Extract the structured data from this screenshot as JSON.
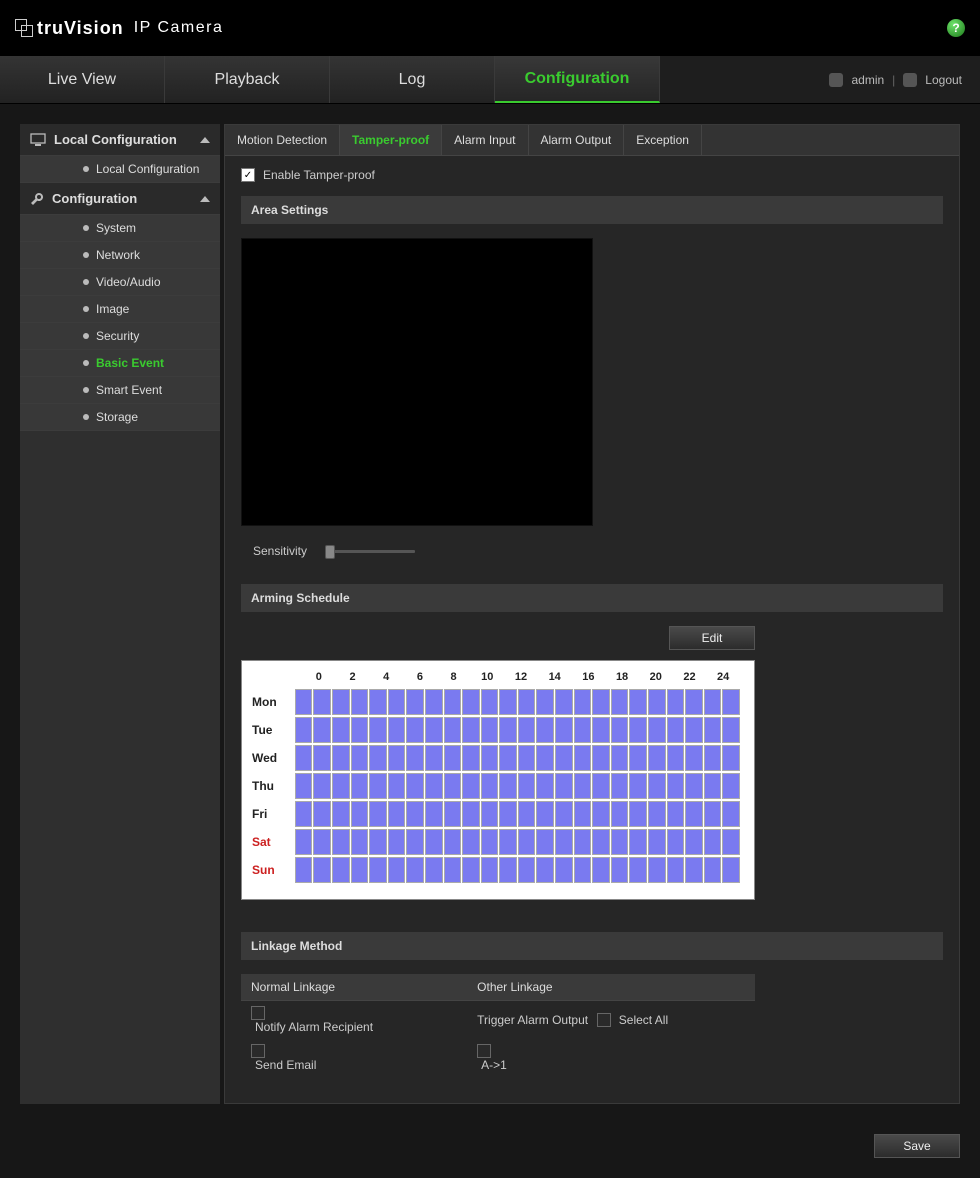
{
  "brand": {
    "main": "truVision",
    "sub": "IP Camera"
  },
  "nav": {
    "tabs": [
      "Live View",
      "Playback",
      "Log",
      "Configuration"
    ],
    "active": "Configuration",
    "user_label": "admin",
    "logout_label": "Logout"
  },
  "sidebar": {
    "sections": [
      {
        "title": "Local Configuration",
        "items": [
          {
            "label": "Local Configuration",
            "active": false
          }
        ]
      },
      {
        "title": "Configuration",
        "items": [
          {
            "label": "System",
            "active": false
          },
          {
            "label": "Network",
            "active": false
          },
          {
            "label": "Video/Audio",
            "active": false
          },
          {
            "label": "Image",
            "active": false
          },
          {
            "label": "Security",
            "active": false
          },
          {
            "label": "Basic Event",
            "active": true
          },
          {
            "label": "Smart Event",
            "active": false
          },
          {
            "label": "Storage",
            "active": false
          }
        ]
      }
    ]
  },
  "sub_tabs": {
    "items": [
      "Motion Detection",
      "Tamper-proof",
      "Alarm Input",
      "Alarm Output",
      "Exception"
    ],
    "active": "Tamper-proof"
  },
  "enable_label": "Enable Tamper-proof",
  "enable_checked": true,
  "area_settings_title": "Area Settings",
  "sensitivity_label": "Sensitivity",
  "sensitivity_value": 0,
  "arming_title": "Arming Schedule",
  "edit_label": "Edit",
  "schedule": {
    "hours": [
      "0",
      "2",
      "4",
      "6",
      "8",
      "10",
      "12",
      "14",
      "16",
      "18",
      "20",
      "22",
      "24"
    ],
    "days": [
      {
        "label": "Mon",
        "weekend": false
      },
      {
        "label": "Tue",
        "weekend": false
      },
      {
        "label": "Wed",
        "weekend": false
      },
      {
        "label": "Thu",
        "weekend": false
      },
      {
        "label": "Fri",
        "weekend": false
      },
      {
        "label": "Sat",
        "weekend": true
      },
      {
        "label": "Sun",
        "weekend": true
      }
    ],
    "cells_per_day": 24,
    "all_filled": true
  },
  "linkage": {
    "title": "Linkage Method",
    "normal_header": "Normal Linkage",
    "other_header": "Other Linkage",
    "notify_label": "Notify Alarm Recipient",
    "send_email_label": "Send Email",
    "trigger_label": "Trigger Alarm Output",
    "select_all_label": "Select All",
    "output_label": "A->1"
  },
  "save_label": "Save",
  "colors": {
    "accent": "#3acb2f",
    "schedule_cell": "#7a7af0"
  }
}
